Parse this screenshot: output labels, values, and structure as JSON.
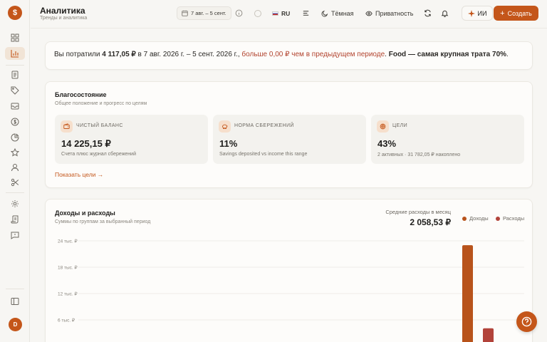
{
  "app": {
    "logo_symbol": "$"
  },
  "header": {
    "title": "Аналитика",
    "subtitle": "Тренды и аналитика",
    "date_range": "7 авг. – 5 сент.",
    "language": "RU",
    "theme_label": "Тёмная",
    "privacy_label": "Приватность",
    "ai_label": "ИИ",
    "create_label": "Создать"
  },
  "user": {
    "avatar_initial": "D"
  },
  "summary": {
    "prefix": "Вы потратили ",
    "amount": "4 117,05 ₽",
    "middle": " в 7 авг. 2026 г. – 5 сент. 2026 г., ",
    "comparison": "больше 0,00 ₽ чем в предыдущем периоде",
    "dot": ". ",
    "top_category": "Food — самая крупная трата 70%",
    "end": "."
  },
  "wellbeing": {
    "title": "Благосостояние",
    "subtitle": "Общее положение и прогресс по целям",
    "kpis": [
      {
        "label": "ЧИСТЫЙ БАЛАНС",
        "value": "14 225,15 ₽",
        "note": "Счета плюс журнал сбережений",
        "icon": "wallet-icon"
      },
      {
        "label": "НОРМА СБЕРЕЖЕНИЙ",
        "value": "11%",
        "note": "Savings deposited vs income this range",
        "icon": "piggy-bank-icon"
      },
      {
        "label": "ЦЕЛИ",
        "value": "43%",
        "note": "2 активных · 31 782,05 ₽ накоплено",
        "icon": "target-icon"
      }
    ],
    "goals_link": "Показать цели →"
  },
  "income_expenses": {
    "title": "Доходы и расходы",
    "subtitle": "Суммы по группам за выбранный период",
    "avg_label": "Средние расходы в месяц",
    "avg_value": "2 058,53 ₽",
    "legend": [
      {
        "label": "Доходы",
        "color": "#b8531b"
      },
      {
        "label": "Расходы",
        "color": "#b2433a"
      }
    ]
  },
  "chart_data": {
    "type": "bar",
    "title": "Доходы и расходы",
    "y_ticks": [
      "24 тыс. ₽",
      "18 тыс. ₽",
      "12 тыс. ₽",
      "6 тыс. ₽"
    ],
    "ylim": [
      0,
      24000
    ],
    "series": [
      {
        "name": "Доходы",
        "values": [
          23000
        ]
      },
      {
        "name": "Расходы",
        "values": [
          4100
        ]
      }
    ],
    "grid": true,
    "legend_position": "top-right"
  }
}
